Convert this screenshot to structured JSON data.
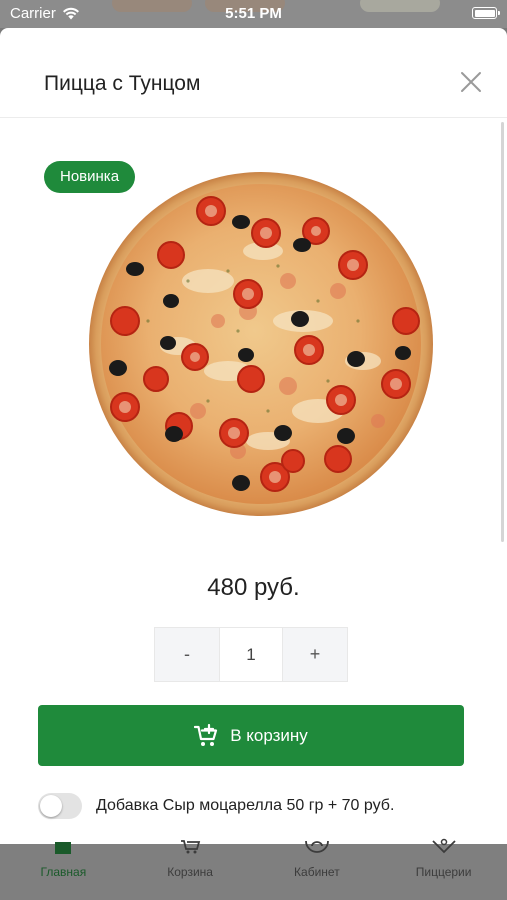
{
  "status_bar": {
    "carrier": "Carrier",
    "time": "5:51 PM"
  },
  "product": {
    "title": "Пицца с Тунцом",
    "badge": "Новинка",
    "price": "480 руб.",
    "quantity": "1",
    "decrement_label": "-",
    "increment_label": "+",
    "add_to_cart_label": "В корзину"
  },
  "addon": {
    "label": "Добавка Сыр моцарелла 50 гр + 70 руб.",
    "enabled": false
  },
  "tabbar": {
    "items": [
      {
        "label": "Главная",
        "icon": "home-icon",
        "active": true
      },
      {
        "label": "Корзина",
        "icon": "cart-icon",
        "active": false
      },
      {
        "label": "Кабинет",
        "icon": "user-icon",
        "active": false
      },
      {
        "label": "Пиццерии",
        "icon": "location-icon",
        "active": false
      }
    ]
  },
  "colors": {
    "accent": "#1f8a3b",
    "badge": "#1f8a3b",
    "dim_overlay": "#7f7f7f"
  }
}
